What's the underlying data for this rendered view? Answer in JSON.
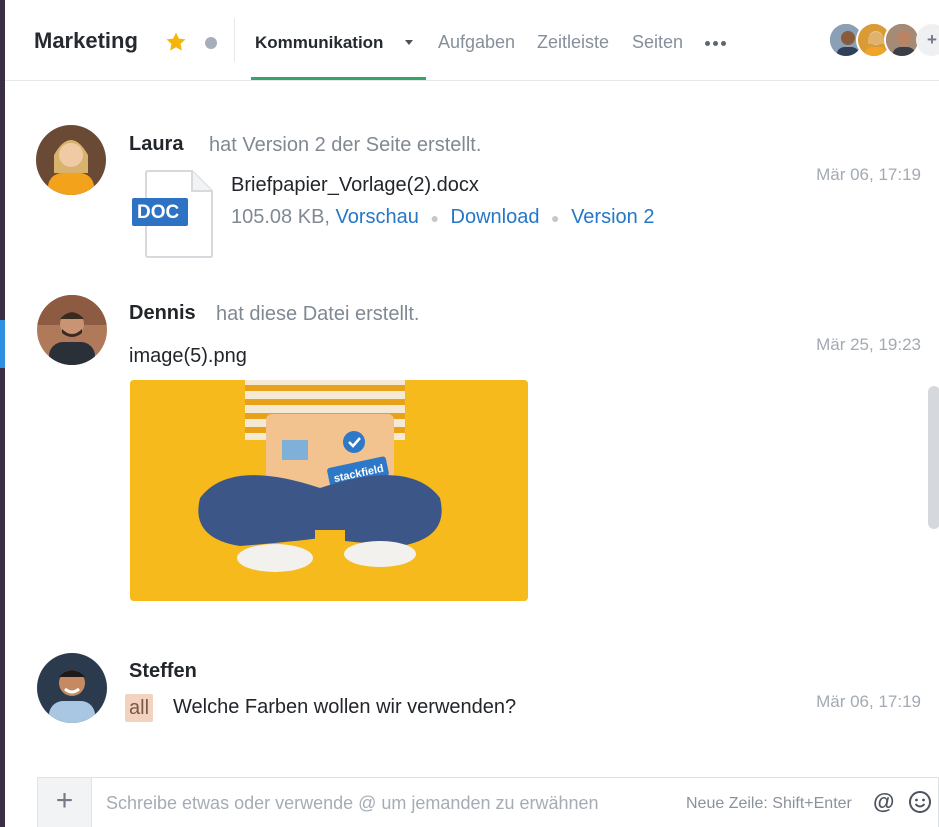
{
  "header": {
    "project_title": "Marketing",
    "tabs": [
      {
        "label": "Kommunikation",
        "active": true
      },
      {
        "label": "Aufgaben"
      },
      {
        "label": "Zeitleiste"
      },
      {
        "label": "Seiten"
      }
    ],
    "add_member_label": "+"
  },
  "feed": [
    {
      "author": "Laura",
      "action": "hat Version 2 der Seite erstellt.",
      "timestamp": "Mär 06, 17:19",
      "file": {
        "badge": "DOC",
        "name": "Briefpapier_Vorlage(2).docx",
        "size": "105.08 KB,",
        "preview_label": "Vorschau",
        "download_label": "Download",
        "version_label": "Version 2"
      }
    },
    {
      "author": "Dennis",
      "action": "hat diese Datei erstellt.",
      "timestamp": "Mär 25, 19:23",
      "image_name": "image(5).png",
      "image_sticker_text": "stackfield"
    },
    {
      "author": "Steffen",
      "timestamp": "Mär 06, 17:19",
      "mention": "all",
      "message": "Welche Farben wollen wir verwenden?"
    }
  ],
  "composer": {
    "add_label": "+",
    "placeholder": "Schreibe etwas oder verwende @ um jemanden zu erwähnen",
    "hint": "Neue Zeile: Shift+Enter",
    "at_label": "@"
  },
  "colors": {
    "accent_green": "#36a56b",
    "link_blue": "#2477c9",
    "star_yellow": "#f5b50a",
    "mention_bg": "#f4d2c0"
  }
}
